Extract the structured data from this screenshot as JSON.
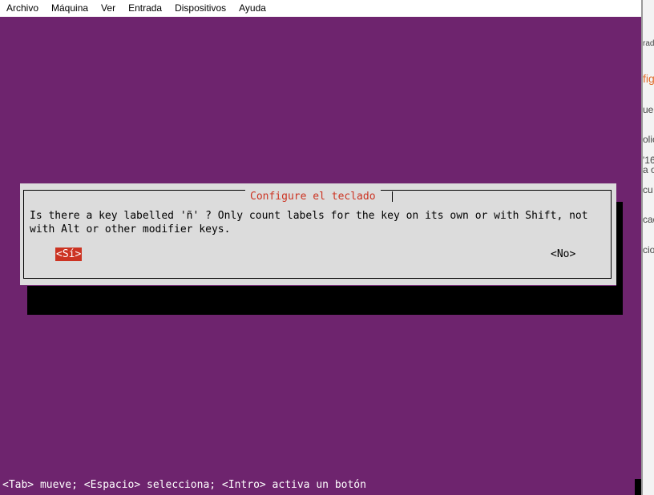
{
  "menubar": {
    "items": [
      {
        "label": "Archivo"
      },
      {
        "label": "Máquina"
      },
      {
        "label": "Ver"
      },
      {
        "label": "Entrada"
      },
      {
        "label": "Dispositivos"
      },
      {
        "label": "Ayuda"
      }
    ]
  },
  "dialog": {
    "title": "Configure el teclado",
    "message": "Is there a key labelled 'ñ' ? Only count labels for the key on its own or with Shift, not\nwith Alt or other modifier keys.",
    "yes_label": "<Sí>",
    "no_label": "<No>"
  },
  "statusbar": {
    "text": "<Tab> mueve; <Espacio> selecciona; <Intro> activa un botón"
  },
  "background_window": {
    "fragments": [
      "rad",
      "fig",
      "ue",
      "olic",
      "'16",
      "a o",
      "cu",
      "cad",
      "cion"
    ]
  },
  "colors": {
    "terminal_background": "#6e246e",
    "dialog_background": "#dcdcdc",
    "accent": "#cc3322",
    "shadow": "#000000"
  }
}
